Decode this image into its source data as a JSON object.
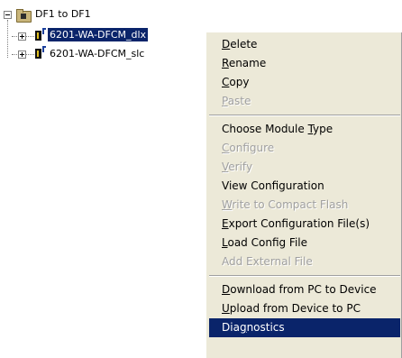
{
  "tree": {
    "root": {
      "label": "DF1 to DF1",
      "expanded": true
    },
    "children": [
      {
        "label": "6201-WA-DFCM_dlx",
        "selected": true,
        "expanded": false
      },
      {
        "label": "6201-WA-DFCM_slc",
        "selected": false,
        "expanded": false
      }
    ]
  },
  "context_menu": {
    "groups": [
      [
        {
          "before": "",
          "mnemonic": "D",
          "after": "elete",
          "enabled": true
        },
        {
          "before": "",
          "mnemonic": "R",
          "after": "ename",
          "enabled": true
        },
        {
          "before": "",
          "mnemonic": "C",
          "after": "opy",
          "enabled": true
        },
        {
          "before": "",
          "mnemonic": "P",
          "after": "aste",
          "enabled": false
        }
      ],
      [
        {
          "before": "Choose Module ",
          "mnemonic": "T",
          "after": "ype",
          "enabled": true
        },
        {
          "before": "",
          "mnemonic": "C",
          "after": "onfigure",
          "enabled": false
        },
        {
          "before": "",
          "mnemonic": "V",
          "after": "erify",
          "enabled": false
        },
        {
          "before": "View Configuration",
          "mnemonic": "",
          "after": "",
          "enabled": true
        },
        {
          "before": "",
          "mnemonic": "W",
          "after": "rite to Compact Flash",
          "enabled": false
        },
        {
          "before": "",
          "mnemonic": "E",
          "after": "xport Configuration File(s)",
          "enabled": true
        },
        {
          "before": "",
          "mnemonic": "L",
          "after": "oad Config File",
          "enabled": true
        },
        {
          "before": "Add External File",
          "mnemonic": "",
          "after": "",
          "enabled": false
        }
      ],
      [
        {
          "before": "",
          "mnemonic": "D",
          "after": "ownload from PC to Device",
          "enabled": true
        },
        {
          "before": "",
          "mnemonic": "U",
          "after": "pload from Device to PC",
          "enabled": true
        },
        {
          "before": "Dia",
          "mnemonic": "g",
          "after": "nostics",
          "enabled": true,
          "highlighted": true
        }
      ]
    ]
  }
}
